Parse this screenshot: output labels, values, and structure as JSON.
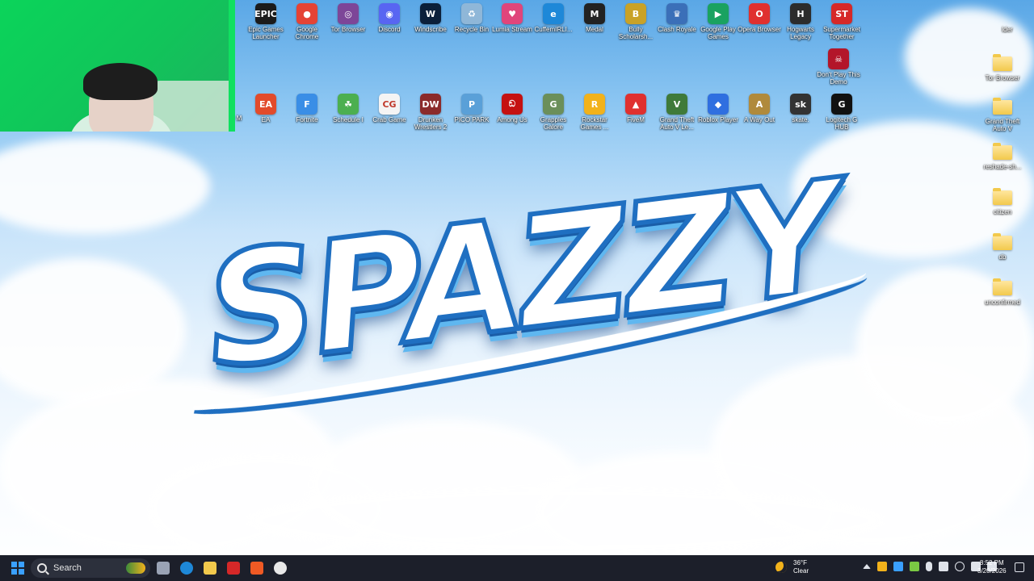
{
  "desktop": {
    "logo_text": "SPAZZY",
    "row1_icons": [
      {
        "label": "Epic Games Launcher",
        "glyph": "EPIC",
        "color": "#1b1b1b"
      },
      {
        "label": "Google Chrome",
        "glyph": "●",
        "color": "#e54335"
      },
      {
        "label": "Tor Browser",
        "glyph": "◎",
        "color": "#7d4698"
      },
      {
        "label": "Discord",
        "glyph": "◉",
        "color": "#5865f2"
      },
      {
        "label": "Windscribe",
        "glyph": "W",
        "color": "#0b1f3a"
      },
      {
        "label": "Recycle Bin",
        "glyph": "♻",
        "color": "#8fb7d8"
      },
      {
        "label": "Lumia Stream",
        "glyph": "♥",
        "color": "#e0457b"
      },
      {
        "label": "CuffemIRLI...",
        "glyph": "e",
        "color": "#1e88d8"
      },
      {
        "label": "Medal",
        "glyph": "M",
        "color": "#222222"
      },
      {
        "label": "Bully Scholarsh...",
        "glyph": "B",
        "color": "#c9a227"
      },
      {
        "label": "Clash Royale",
        "glyph": "♛",
        "color": "#3b6fb8"
      },
      {
        "label": "Google Play Games",
        "glyph": "▶",
        "color": "#1aa260"
      },
      {
        "label": "Opera Browser",
        "glyph": "O",
        "color": "#e0302f"
      },
      {
        "label": "Hogwarts Legacy",
        "glyph": "H",
        "color": "#2c2c2c"
      },
      {
        "label": "Supermarket Together",
        "glyph": "ST",
        "color": "#d62828"
      }
    ],
    "row2_icons": [
      {
        "label": "EA",
        "glyph": "EA",
        "color": "#e24b2b"
      },
      {
        "label": "Fortnite",
        "glyph": "F",
        "color": "#3a8ee6"
      },
      {
        "label": "Schedule I",
        "glyph": "☘",
        "color": "#4caf50"
      },
      {
        "label": "Crab Game",
        "glyph": "CG",
        "color": "#f4f4f4"
      },
      {
        "label": "Drunken Wrestlers 2",
        "glyph": "DW",
        "color": "#8b2a2a"
      },
      {
        "label": "PICO PARK",
        "glyph": "P",
        "color": "#5aa0d8"
      },
      {
        "label": "Among Us",
        "glyph": "ඞ",
        "color": "#c51111"
      },
      {
        "label": "Grapples Galore",
        "glyph": "G",
        "color": "#6b8f5a"
      },
      {
        "label": "Rockstar Games ...",
        "glyph": "R",
        "color": "#f2b21b"
      },
      {
        "label": "FiveM",
        "glyph": "▲",
        "color": "#e0302f"
      },
      {
        "label": "Grand Theft Auto V Le...",
        "glyph": "V",
        "color": "#3f7a3a"
      },
      {
        "label": "Roblox Player",
        "glyph": "◆",
        "color": "#2f6fe0"
      },
      {
        "label": "A Way Out",
        "glyph": "A",
        "color": "#b08a3c"
      },
      {
        "label": "skate.",
        "glyph": "sk",
        "color": "#333333"
      },
      {
        "label": "Logitech G HUB",
        "glyph": "G",
        "color": "#111111"
      }
    ],
    "row2_partial_label": "M",
    "col3_icon": {
      "label": "Don't Play This Demo",
      "glyph": "☠",
      "color": "#b3162a"
    },
    "right_column": [
      {
        "label": "Tor Browser",
        "type": "folder"
      },
      {
        "label": "Grand Theft Auto V",
        "type": "folder"
      },
      {
        "label": "reshade-sh...",
        "type": "folder"
      },
      {
        "label": "citizen",
        "type": "folder"
      },
      {
        "label": "db",
        "type": "folder"
      },
      {
        "label": "unconfirmed",
        "type": "folder"
      }
    ],
    "right_top_partial": "lder"
  },
  "taskbar": {
    "search_label": "Search",
    "weather_temp": "36°F",
    "weather_desc": "Clear",
    "time": "8:52 PM",
    "date": "3/20/2026",
    "apps": [
      {
        "name": "task-view",
        "color": "#9aa3b5"
      },
      {
        "name": "edge",
        "color": "#1e88d8"
      },
      {
        "name": "file-explorer",
        "color": "#f2c94c"
      },
      {
        "name": "acrobat",
        "color": "#d62828"
      },
      {
        "name": "brave",
        "color": "#f05a24"
      },
      {
        "name": "obs",
        "color": "#e8e8e8"
      }
    ]
  },
  "colors": {
    "taskbar": "#1c1f2a",
    "webcam_green": "#0bd45a",
    "logo_blue": "#1f6fc1"
  }
}
